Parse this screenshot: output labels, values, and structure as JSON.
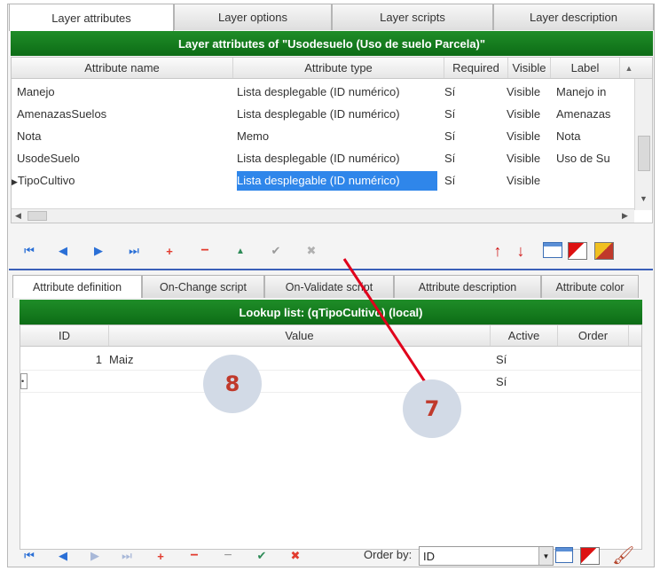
{
  "top_tabs": [
    {
      "label": "Layer attributes"
    },
    {
      "label": "Layer options"
    },
    {
      "label": "Layer scripts"
    },
    {
      "label": "Layer description"
    }
  ],
  "top_banner": "Layer attributes of \"Usodesuelo (Uso de suelo Parcela)\"",
  "top_columns": [
    "Attribute name",
    "Attribute type",
    "Required",
    "Visible",
    "Label"
  ],
  "top_rows": [
    {
      "name": "Manejo",
      "type": "Lista desplegable (ID numérico)",
      "required": "Sí",
      "visible": "Visible",
      "label": "Manejo in"
    },
    {
      "name": "AmenazasSuelos",
      "type": "Lista desplegable (ID numérico)",
      "required": "Sí",
      "visible": "Visible",
      "label": "Amenazas"
    },
    {
      "name": "Nota",
      "type": "Memo",
      "required": "Sí",
      "visible": "Visible",
      "label": "Nota"
    },
    {
      "name": "UsodeSuelo",
      "type": "Lista desplegable (ID numérico)",
      "required": "Sí",
      "visible": "Visible",
      "label": "Uso de Su"
    },
    {
      "name": "TipoCultivo",
      "type": "Lista desplegable (ID numérico)",
      "required": "Sí",
      "visible": "Visible",
      "label": ""
    }
  ],
  "bottom_tabs": [
    {
      "label": "Attribute definition"
    },
    {
      "label": "On-Change script"
    },
    {
      "label": "On-Validate script"
    },
    {
      "label": "Attribute description"
    },
    {
      "label": "Attribute color"
    }
  ],
  "bottom_banner": "Lookup list: (qTipoCultivo) (local)",
  "bottom_columns": [
    "ID",
    "Value",
    "Active",
    "Order"
  ],
  "bottom_rows": [
    {
      "id": "1",
      "value": "Maiz",
      "active": "Sí",
      "order": ""
    },
    {
      "id": "",
      "value": "",
      "active": "Sí",
      "order": ""
    }
  ],
  "order_by_label": "Order by:",
  "order_by_value": "ID",
  "annotations": {
    "seven": "7",
    "eight": "8"
  },
  "colors": {
    "banner_green": "#0d6c16",
    "selection_blue": "#2f86ea",
    "annotation_red": "#e0001b",
    "separator_blue": "#3a5fb8"
  }
}
